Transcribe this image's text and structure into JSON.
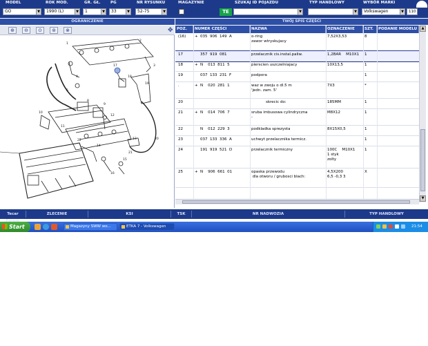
{
  "toolbar": {
    "fields": [
      {
        "label": "MODEL",
        "value": "GO"
      },
      {
        "label": "ROK MOD.",
        "value": "1990 (L)"
      },
      {
        "label": "GR. GŁ.",
        "value": "1"
      },
      {
        "label": "PG",
        "value": "33"
      },
      {
        "label": "NR RYSUNKU",
        "value": "52-75"
      }
    ],
    "magazine_label": "MAGAZYNIE",
    "te_badge": "TE",
    "vin_label": "SZUKAJ ID POJAZDU",
    "trade_label": "TYP HANDLOWY",
    "brand_label": "WYBÓR MARKI",
    "brand_value": "Volkswagen",
    "brand_code": "110"
  },
  "sections": {
    "left": "OGRANICZENIE",
    "right": "TWÓJ SPIS CZĘŚCI"
  },
  "table": {
    "columns": [
      "POZ.",
      "NUMER CZĘŚCI",
      "NAZWA",
      "OZNACZENIE",
      "SZT.",
      "PODANIE MODELU"
    ],
    "rows": [
      {
        "poz": "(16)",
        "flag": "+",
        "num": "035  906  149  A",
        "name": "o-ring\nzawor wtryskujacy",
        "oznacz": "7,52X3,53",
        "szt": "8",
        "h": 26,
        "sel": false
      },
      {
        "poz": "17",
        "flag": "",
        "num": "357  919  081",
        "name": "przelacznik cis.instal.paliw.",
        "oznacz": "1,2BAR    M10X1",
        "szt": "1",
        "h": 15,
        "sel": true
      },
      {
        "poz": "18",
        "flag": "+",
        "num": "N    013  811  5",
        "name": "pierscien uszczelniajacy",
        "oznacz": "10X13,5",
        "szt": "1",
        "h": 15,
        "sel": false
      },
      {
        "poz": "19",
        "flag": "",
        "num": "037  133  231  F",
        "name": "podpora",
        "oznacz": "",
        "szt": "1",
        "h": 15,
        "sel": false
      },
      {
        "poz": ".",
        "flag": "+",
        "num": "N    020  281  1",
        "name": "waz w zwoju o dl.5 m\n'jedn. zam. 5'",
        "oznacz": "7X3",
        "szt": "*",
        "h": 24,
        "sel": false
      },
      {
        "poz": "20",
        "flag": "",
        "num": "",
        "name": "            skrecic do:",
        "oznacz": "185MM",
        "szt": "1",
        "h": 15,
        "sel": false
      },
      {
        "poz": "21",
        "flag": "+",
        "num": "N    014  706  7",
        "name": "sruba imbusowa cylindryczna\n-",
        "oznacz": "M8X12",
        "szt": "1",
        "h": 24,
        "sel": false
      },
      {
        "poz": "22",
        "flag": "",
        "num": "N    012  229  3",
        "name": "podkladka sprezysta",
        "oznacz": "8X15X0,5",
        "szt": "1",
        "h": 15,
        "sel": false
      },
      {
        "poz": "23",
        "flag": "",
        "num": "037  133  336  A",
        "name": "uchwyt przelacznika termicz.",
        "oznacz": "",
        "szt": "1",
        "h": 15,
        "sel": false
      },
      {
        "poz": "24",
        "flag": "",
        "num": "191  919  521  D",
        "name": "przelacznik termiczny",
        "oznacz": "100C    M10X1\n1 styk\nzolty",
        "szt": "1",
        "h": 32,
        "sel": false
      },
      {
        "poz": "25",
        "flag": "+",
        "num": "N    906  661  01",
        "name": "opaska przewodu\n dla otworu / grubosci blach:",
        "oznacz": "4,5X200\n6,5 -0,3 3",
        "szt": "X",
        "h": 28,
        "sel": false
      }
    ]
  },
  "bottom_tabs": [
    "Tecar Forum",
    "ZLECENIE",
    "KSI",
    "TSK",
    "NR NADWOZIA",
    "TYP HANDLOWY"
  ],
  "taskbar": {
    "start_label": "Start",
    "tasks": [
      "Magazyny SWW wo...",
      "ETKA 7 - Volkswagen"
    ],
    "clock": "21:54"
  },
  "colors": {
    "toolbar_bg": "#1d3a8a",
    "header_bg": "#2e4fa6",
    "te_badge": "#17a34a",
    "taskbar": "#2458d0",
    "start_button": "#3a9d36"
  }
}
